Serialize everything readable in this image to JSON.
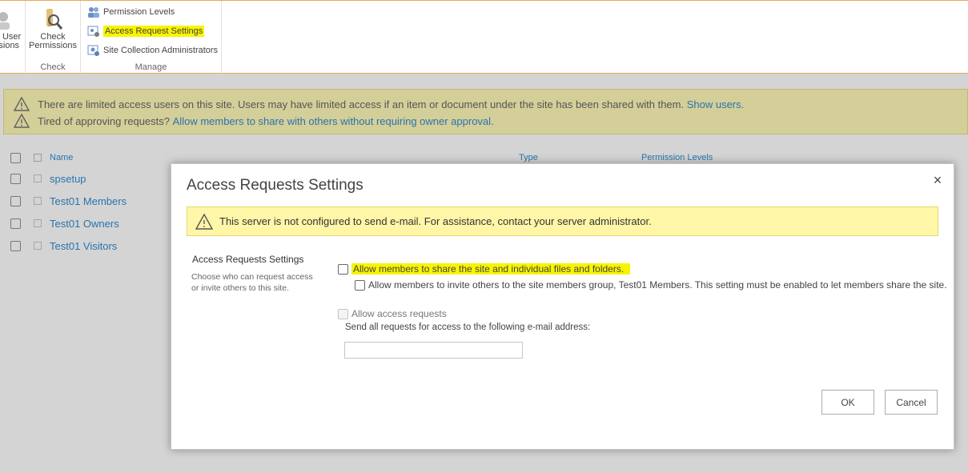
{
  "ribbon": {
    "partial_button_label_line1": "e User",
    "partial_button_label_line2": "isions",
    "check_permissions_line1": "Check",
    "check_permissions_line2": "Permissions",
    "check_group": "Check",
    "permission_levels": "Permission Levels",
    "access_request_settings": "Access Request Settings",
    "site_collection_admins": "Site Collection Administrators",
    "manage_group": "Manage"
  },
  "status": {
    "line1_text": "There are limited access users on this site. Users may have limited access if an item or document under the site has been shared with them.",
    "line1_link": "Show users.",
    "line2_text": "Tired of approving requests?",
    "line2_link": "Allow members to share with others without requiring owner approval."
  },
  "list": {
    "columns": {
      "name": "Name",
      "type": "Type",
      "permission_levels": "Permission Levels"
    },
    "rows": [
      {
        "name": "spsetup"
      },
      {
        "name": "Test01 Members"
      },
      {
        "name": "Test01 Owners"
      },
      {
        "name": "Test01 Visitors"
      }
    ]
  },
  "dialog": {
    "title": "Access Requests Settings",
    "close_glyph": "×",
    "warning": "This server is not configured to send e-mail. For assistance, contact your server administrator.",
    "section_title": "Access Requests Settings",
    "section_desc": "Choose who can request access or invite others to this site.",
    "option_share": "Allow members to share the site and individual files and folders.",
    "option_invite": "Allow members to invite others to the site members group, Test01 Members. This setting must be enabled to let members share the site.",
    "option_access_requests": "Allow access requests",
    "email_label": "Send all requests for access to the following e-mail address:",
    "email_value": "",
    "ok_label": "OK",
    "cancel_label": "Cancel"
  },
  "colors": {
    "highlight": "#f8f400",
    "link": "#0072c6",
    "warning_bg": "#fff6a8",
    "ribbon_border": "#e8a855"
  }
}
